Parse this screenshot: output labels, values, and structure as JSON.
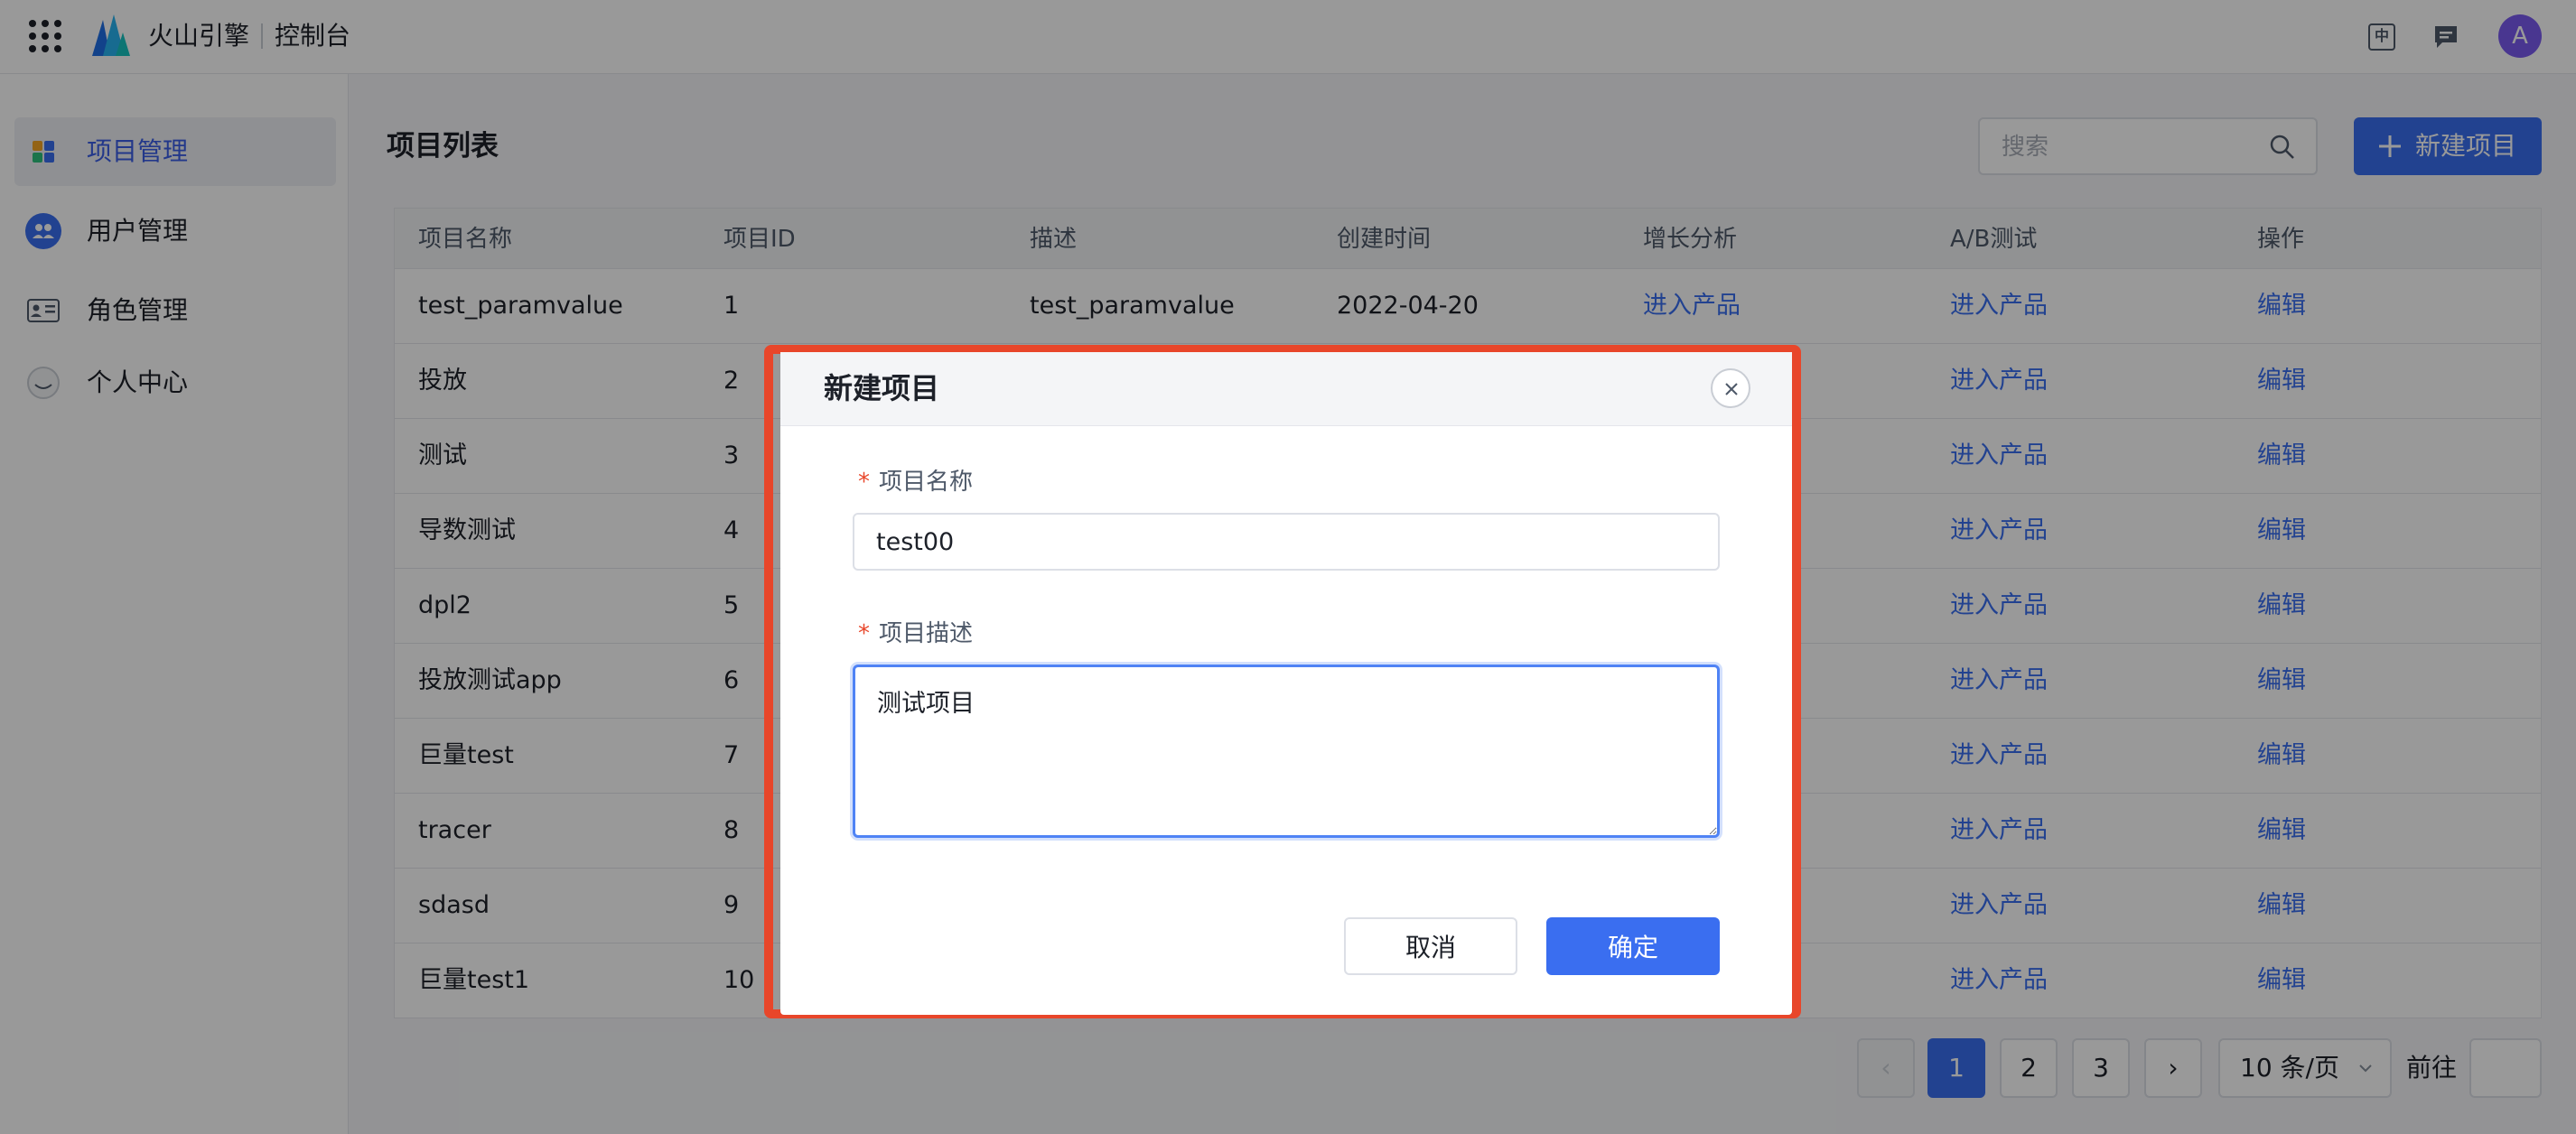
{
  "header": {
    "brand": "火山引擎",
    "console": "控制台",
    "lang_label": "中",
    "avatar_letter": "A"
  },
  "sidebar": {
    "items": [
      {
        "label": "项目管理",
        "icon": "grid-apps-icon",
        "active": true
      },
      {
        "label": "用户管理",
        "icon": "users-icon",
        "active": false
      },
      {
        "label": "角色管理",
        "icon": "id-card-icon",
        "active": false
      },
      {
        "label": "个人中心",
        "icon": "user-circle-icon",
        "active": false
      }
    ]
  },
  "main": {
    "title": "项目列表",
    "search_placeholder": "搜索",
    "new_button": "新建项目"
  },
  "table": {
    "columns": [
      "项目名称",
      "项目ID",
      "描述",
      "创建时间",
      "增长分析",
      "A/B测试",
      "操作"
    ],
    "rows": [
      {
        "name": "test_paramvalue",
        "id": "1",
        "desc": "test_paramvalue",
        "created": "2022-04-20",
        "growth": "进入产品",
        "ab": "进入产品",
        "op": "编辑"
      },
      {
        "name": "投放",
        "id": "2",
        "desc": "",
        "created": "",
        "growth": "",
        "ab": "进入产品",
        "op": "编辑"
      },
      {
        "name": "测试",
        "id": "3",
        "desc": "",
        "created": "",
        "growth": "",
        "ab": "进入产品",
        "op": "编辑"
      },
      {
        "name": "导数测试",
        "id": "4",
        "desc": "",
        "created": "",
        "growth": "",
        "ab": "进入产品",
        "op": "编辑"
      },
      {
        "name": "dpl2",
        "id": "5",
        "desc": "",
        "created": "",
        "growth": "",
        "ab": "进入产品",
        "op": "编辑"
      },
      {
        "name": "投放测试app",
        "id": "6",
        "desc": "",
        "created": "",
        "growth": "",
        "ab": "进入产品",
        "op": "编辑"
      },
      {
        "name": "巨量test",
        "id": "7",
        "desc": "",
        "created": "",
        "growth": "",
        "ab": "进入产品",
        "op": "编辑"
      },
      {
        "name": "tracer",
        "id": "8",
        "desc": "",
        "created": "",
        "growth": "",
        "ab": "进入产品",
        "op": "编辑"
      },
      {
        "name": "sdasd",
        "id": "9",
        "desc": "",
        "created": "",
        "growth": "",
        "ab": "进入产品",
        "op": "编辑"
      },
      {
        "name": "巨量test1",
        "id": "10",
        "desc": "",
        "created": "",
        "growth": "",
        "ab": "进入产品",
        "op": "编辑"
      }
    ]
  },
  "pagination": {
    "pages": [
      "1",
      "2",
      "3"
    ],
    "current": "1",
    "page_size": "10 条/页",
    "goto_label": "前往"
  },
  "modal": {
    "title": "新建项目",
    "name_label": "项目名称",
    "name_value": "test00",
    "desc_label": "项目描述",
    "desc_value": "测试项目",
    "required_mark": "*",
    "cancel": "取消",
    "confirm": "确定"
  },
  "colors": {
    "primary": "#3a6ef0",
    "highlight_frame": "#e8462a"
  }
}
